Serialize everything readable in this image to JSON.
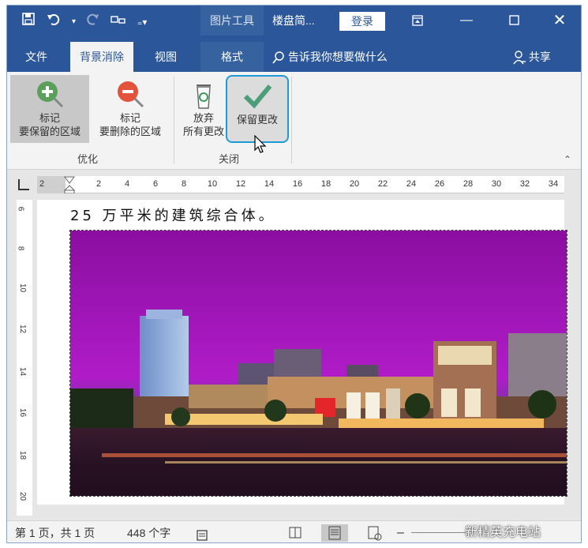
{
  "titlebar": {
    "qat_icons": [
      "save-icon",
      "undo-icon",
      "redo-icon",
      "customize-qat-icon",
      "dropdown-icon"
    ],
    "context_group": "图片工具",
    "doc_title": "楼盘简...",
    "login": "登录",
    "bg_color": "#2b579a"
  },
  "tabs": {
    "file": "文件",
    "bg_remove": "背景消除",
    "view": "视图",
    "format": "格式",
    "tell_me": "告诉我你想要做什么",
    "share": "共享"
  },
  "ribbon": {
    "mark_keep": [
      "标记",
      "要保留的区域"
    ],
    "mark_remove": [
      "标记",
      "要删除的区域"
    ],
    "discard": [
      "放弃",
      "所有更改"
    ],
    "keep_changes": "保留更改",
    "group_refine": "优化",
    "group_close": "关闭"
  },
  "ruler": {
    "h_ticks": [
      "2",
      "2",
      "4",
      "6",
      "8",
      "10",
      "12",
      "14",
      "16",
      "18",
      "20",
      "22",
      "24",
      "26",
      "28",
      "30",
      "32",
      "34"
    ],
    "v_ticks": [
      "6",
      "8",
      "10",
      "12",
      "14",
      "16",
      "18",
      "20"
    ]
  },
  "document": {
    "text": "25 万平米的建筑综合体。"
  },
  "status": {
    "page": "第 1 页，共 1 页",
    "words": "448 个字",
    "watermark": "新精英充电站"
  }
}
